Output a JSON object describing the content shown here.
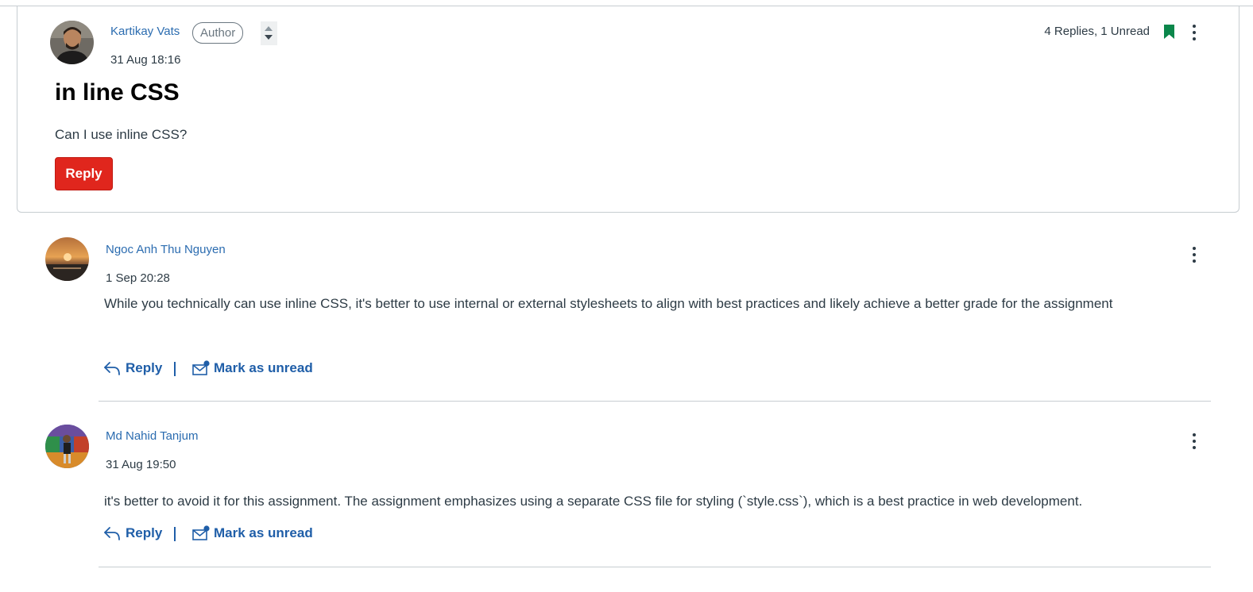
{
  "post": {
    "author": "Kartikay Vats",
    "badge": "Author",
    "date": "31 Aug 18:16",
    "title": "in line CSS",
    "body": "Can I use inline CSS?",
    "reply_button": "Reply",
    "replies_summary": "4 Replies, 1 Unread"
  },
  "replies": [
    {
      "author": "Ngoc Anh Thu Nguyen",
      "date": "1 Sep 20:28",
      "text": "While you technically can use inline CSS, it's better to use internal or external stylesheets to align with best practices and likely achieve a better grade for the assignment",
      "reply_label": "Reply",
      "unread_label": "Mark as unread"
    },
    {
      "author": "Md Nahid Tanjum",
      "date": "31 Aug 19:50",
      "text": "it's better to avoid it for this assignment. The assignment emphasizes using a separate CSS file for styling (`style.css`), which is a best practice in web development.",
      "reply_label": "Reply",
      "unread_label": "Mark as unread"
    }
  ],
  "colors": {
    "link": "#2b6cb0",
    "action": "#1f5ea8",
    "reply_button": "#e0261d",
    "bookmark": "#0b874b"
  },
  "icons": [
    "bookmark-icon",
    "more-options-icon",
    "sort-arrows-icon",
    "reply-arrow-icon",
    "mark-unread-icon"
  ]
}
